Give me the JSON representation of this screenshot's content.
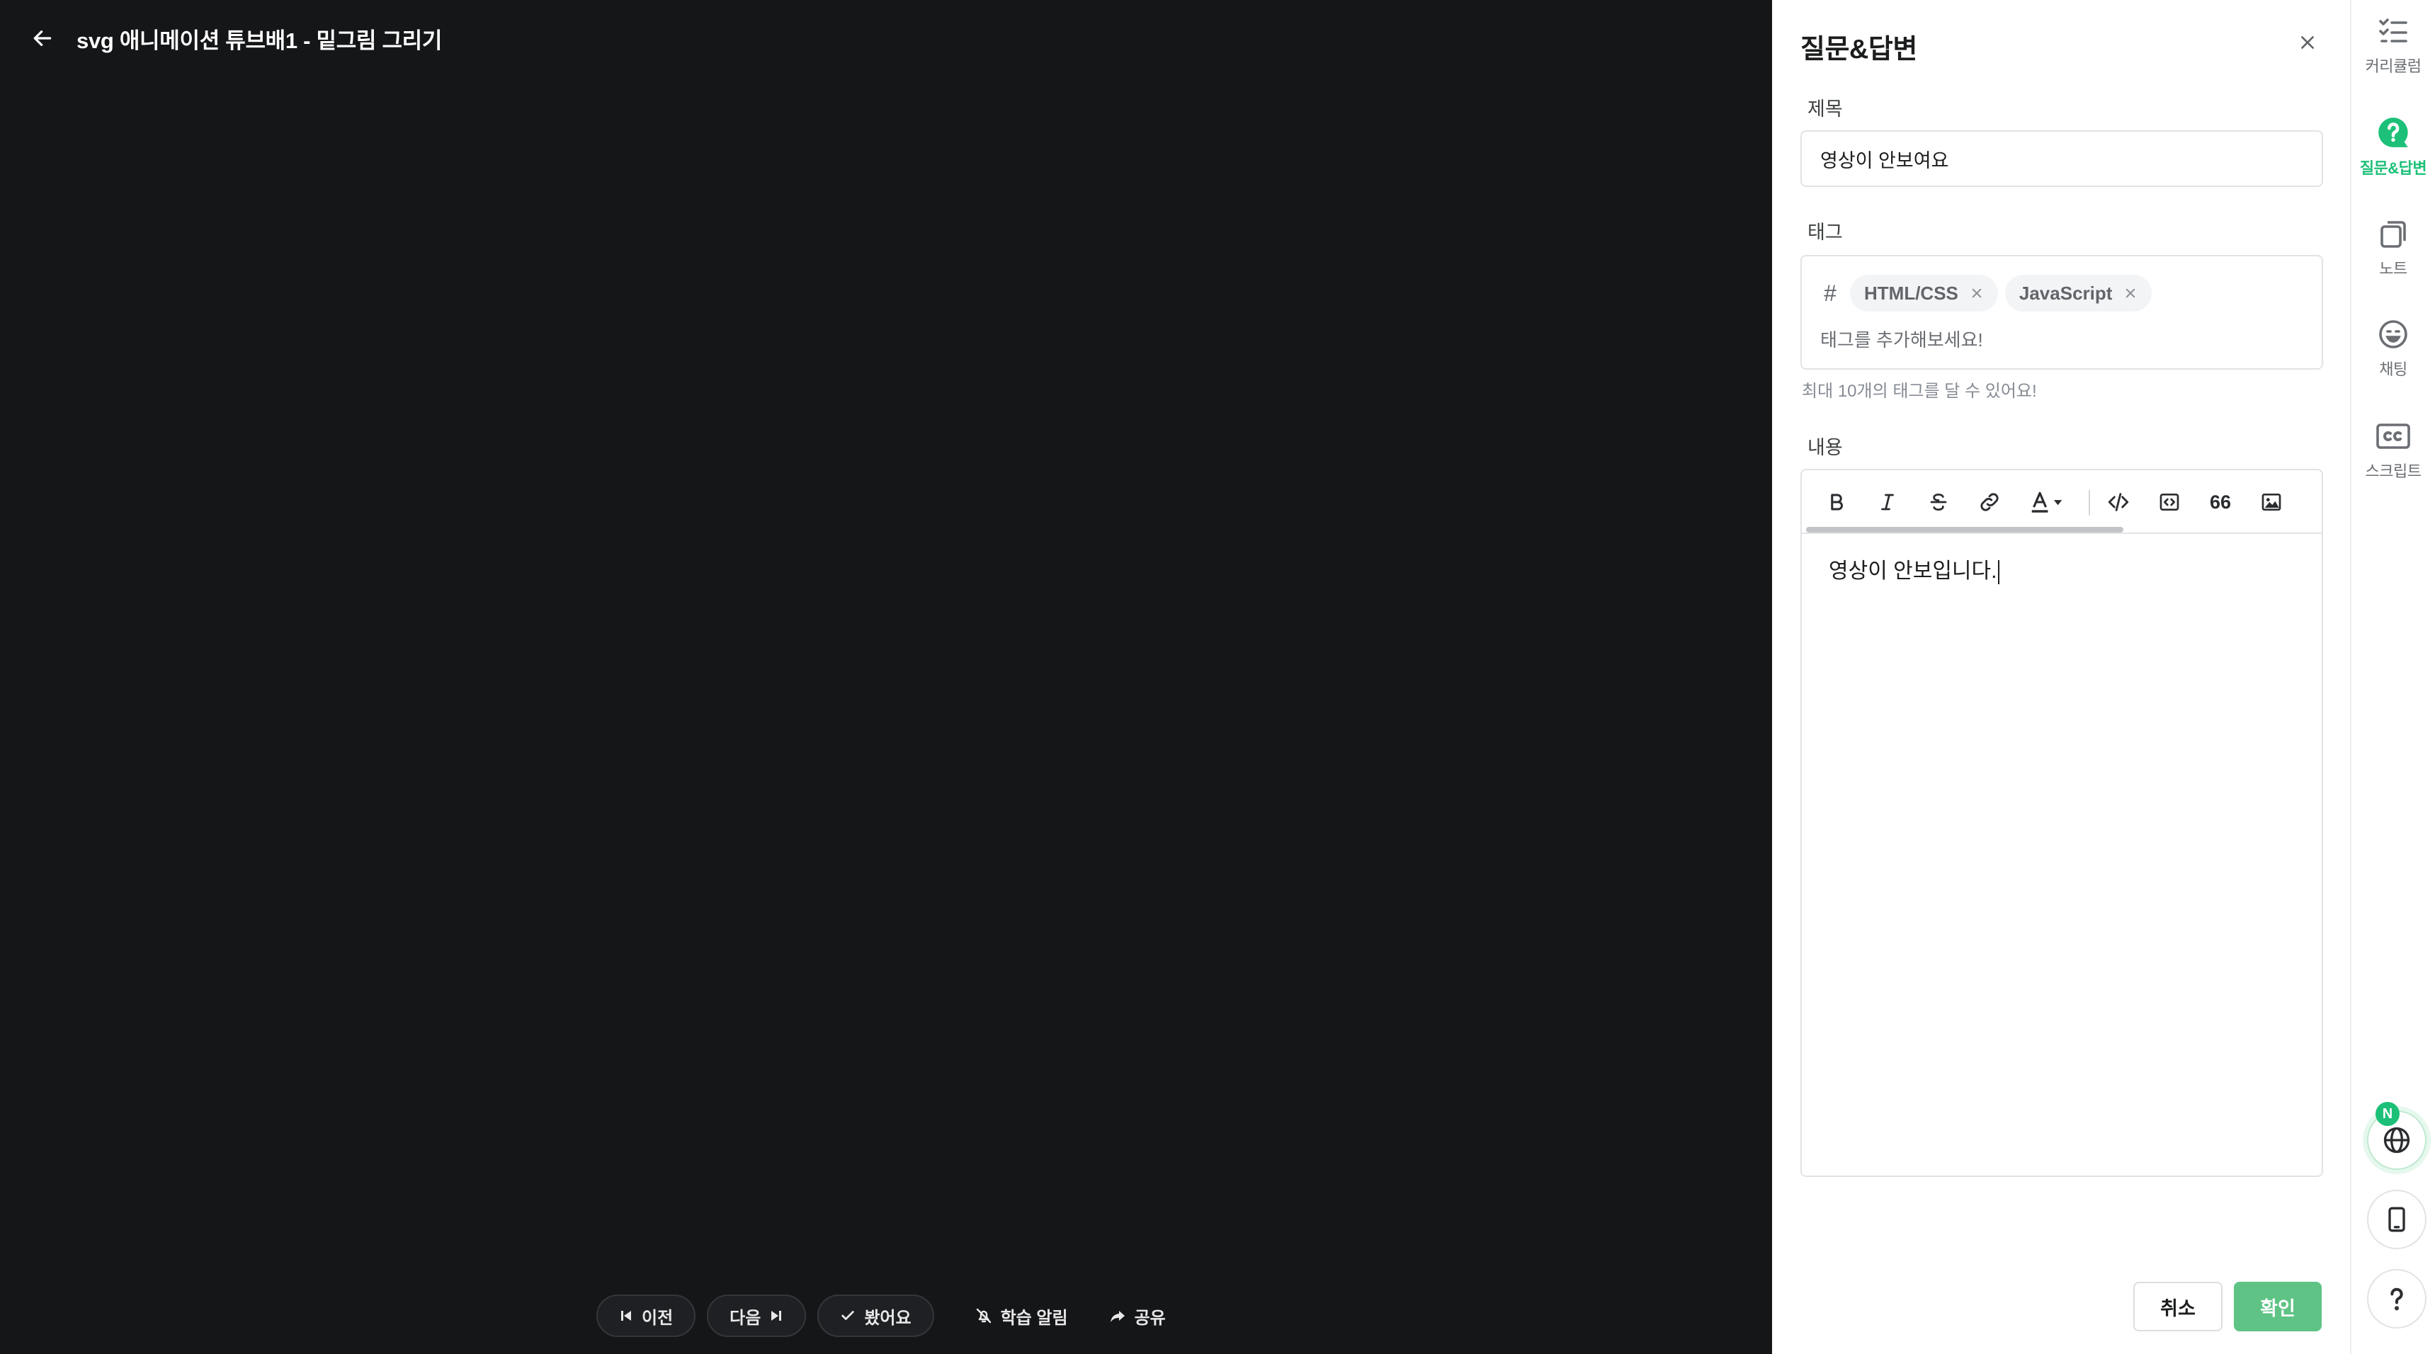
{
  "video": {
    "title": "svg 애니메이션 튜브배1 - 밑그림 그리기",
    "controls": {
      "prev": "이전",
      "next": "다음",
      "watched": "봤어요",
      "notify": "학습 알림",
      "share": "공유"
    }
  },
  "qna_panel": {
    "title": "질문&답변",
    "title_label": "제목",
    "title_value": "영상이 안보여요",
    "tag_label": "태그",
    "tags": [
      "HTML/CSS",
      "JavaScript"
    ],
    "tag_placeholder": "태그를 추가해보세요!",
    "tag_hint": "최대 10개의 태그를 달 수 있어요!",
    "content_label": "내용",
    "content_value": "영상이 안보입니다.",
    "toolbar": {
      "quote_label": "66"
    },
    "cancel_label": "취소",
    "confirm_label": "확인"
  },
  "sidebar": {
    "items": [
      {
        "label": "커리큘럼",
        "icon": "checklist-icon"
      },
      {
        "label": "질문&답변",
        "icon": "question-icon",
        "active": true
      },
      {
        "label": "노트",
        "icon": "copy-icon"
      },
      {
        "label": "채팅",
        "icon": "smile-icon"
      },
      {
        "label": "스크립트",
        "icon": "cc-icon"
      }
    ],
    "badge": "N"
  },
  "colors": {
    "accent": "#1dc078",
    "confirm_button": "#5fc385",
    "video_background": "#151618"
  }
}
